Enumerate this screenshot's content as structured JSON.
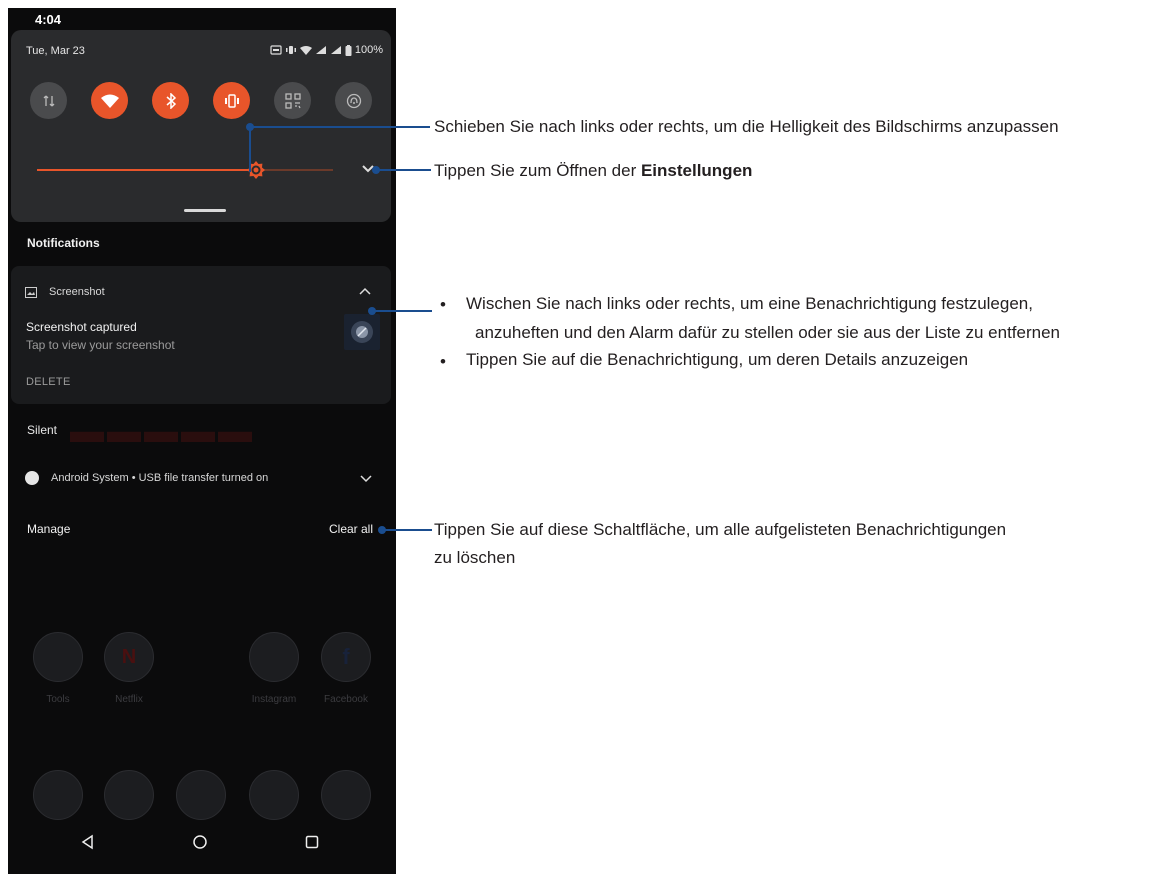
{
  "status_bar": {
    "time": "4:04"
  },
  "quick_settings": {
    "date": "Tue, Mar 23",
    "battery": "100%",
    "tiles": [
      {
        "name": "mobile-data",
        "state": "off"
      },
      {
        "name": "wifi",
        "state": "on"
      },
      {
        "name": "bluetooth",
        "state": "on"
      },
      {
        "name": "vibrate",
        "state": "on"
      },
      {
        "name": "qr-scanner",
        "state": "off"
      },
      {
        "name": "nfc",
        "state": "off"
      }
    ],
    "brightness": 0.74,
    "accent": "#e8552a"
  },
  "notifications": {
    "header": "Notifications",
    "card": {
      "app": "Screenshot",
      "title": "Screenshot captured",
      "subtitle": "Tap to view your screenshot",
      "action": "DELETE"
    },
    "silent_header": "Silent",
    "system": {
      "text": "Android System • USB file transfer turned on"
    },
    "manage": "Manage",
    "clear_all": "Clear all"
  },
  "home_apps": [
    {
      "label": "Tools"
    },
    {
      "label": "Netflix"
    },
    {
      "label": "Instagram"
    },
    {
      "label": "Facebook"
    }
  ],
  "callouts": {
    "brightness": "Schieben Sie nach links oder rechts, um die Helligkeit des Bildschirms anzupassen",
    "settings_prefix": "Tippen Sie zum Öffnen der ",
    "settings_bold": "Einstellungen",
    "swipe_line1": "Wischen Sie nach links oder rechts, um eine Benachrichtigung festzulegen,",
    "swipe_line2": "anzuheften und den Alarm dafür zu stellen oder sie aus der Liste zu entfernen",
    "tap_details": "Tippen Sie auf die Benachrichtigung, um deren Details anzuzeigen",
    "clear_line1": "Tippen Sie auf diese Schaltfläche, um alle aufgelisteten Benachrichtigungen",
    "clear_line2": "zu löschen",
    "bullet": "•",
    "line_color": "#1a4d8f"
  }
}
